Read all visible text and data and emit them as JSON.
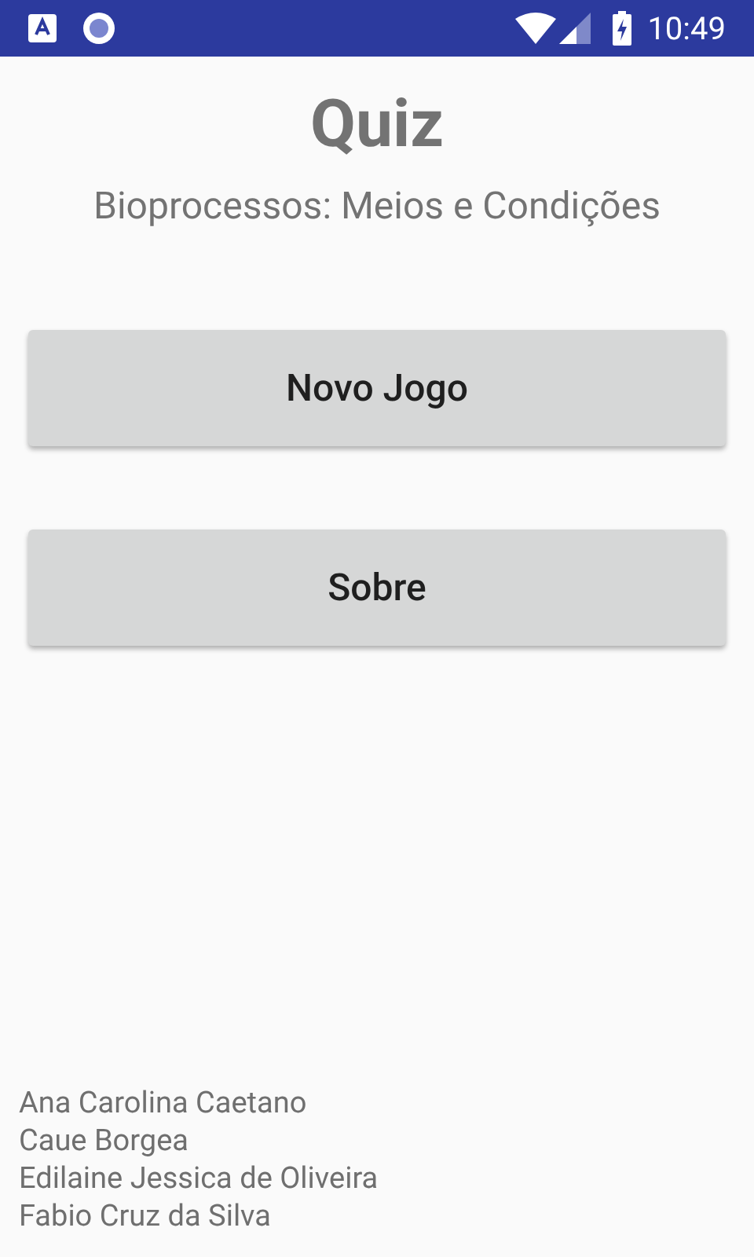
{
  "status_bar": {
    "time": "10:49"
  },
  "title": "Quiz",
  "subtitle": "Bioprocessos: Meios e Condições",
  "buttons": [
    "Novo Jogo",
    "Sobre"
  ],
  "authors": [
    "Ana Carolina Caetano",
    "Caue Borgea",
    "Edilaine Jessica de Oliveira",
    "Fabio Cruz da Silva"
  ]
}
